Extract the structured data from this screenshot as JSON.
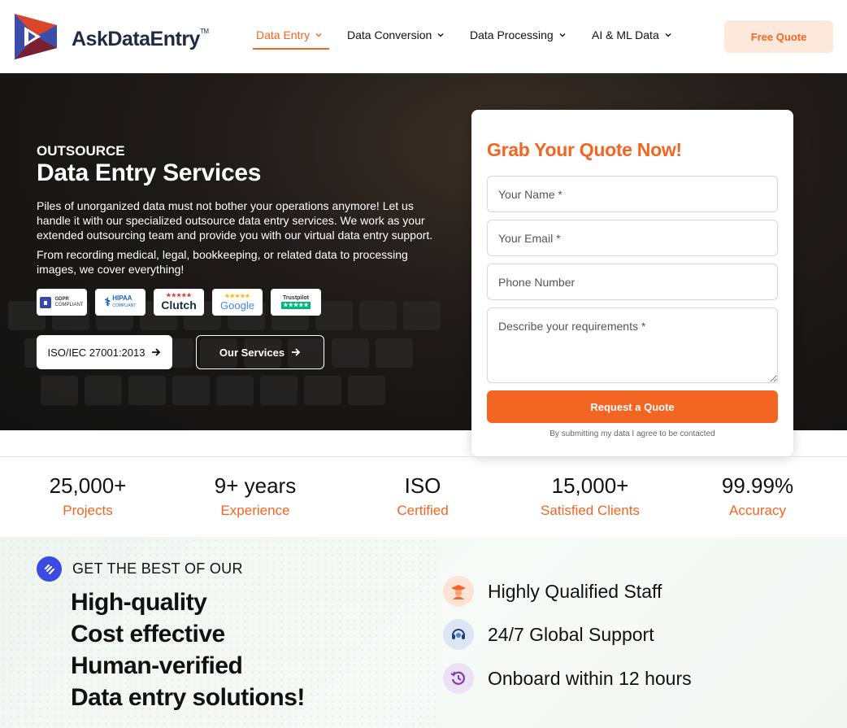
{
  "header": {
    "logo_text": "AskDataEntry",
    "logo_tm": "TM",
    "nav": [
      {
        "label": "Data Entry"
      },
      {
        "label": "Data Conversion"
      },
      {
        "label": "Data Processing"
      },
      {
        "label": "AI & ML Data"
      }
    ],
    "cta": "Free Quote",
    "accent": "#f26522"
  },
  "hero": {
    "eyebrow": "OUTSOURCE",
    "title": "Data Entry Services",
    "p1": "Piles of unorganized data must not bother your operations anymore! Let us handle it with our specialized outsource data entry services. We work as your extended outsourcing team and provide you with our virtual data entry support.",
    "p2": "From recording medical, legal, bookkeeping, or related data to processing images, we cover everything!",
    "badges": [
      {
        "label": "GDPR",
        "sub": "COMPLIANT"
      },
      {
        "label": "HIPAA",
        "sub": "COMPLIANT"
      },
      {
        "label": "Clutch",
        "sub": "★★★★★"
      },
      {
        "label": "Google",
        "sub": "★★★★★"
      },
      {
        "label": "Trustpilot",
        "sub": "★★★★★"
      }
    ],
    "btn_iso": "ISO/IEC 27001:2013",
    "btn_services": "Our Services"
  },
  "form": {
    "title": "Grab Your Quote Now!",
    "name_placeholder": "Your Name *",
    "email_placeholder": "Your Email *",
    "phone_placeholder": "Phone Number",
    "req_placeholder": "Describe your requirements *",
    "submit": "Request a Quote",
    "note": "By submitting my data I agree to be contacted"
  },
  "stats": [
    {
      "value": "25,000+",
      "label": "Projects"
    },
    {
      "value": "9+ years",
      "label": "Experience"
    },
    {
      "value": "ISO",
      "label": "Certified"
    },
    {
      "value": "15,000+",
      "label": "Satisfied Clients"
    },
    {
      "value": "99.99%",
      "label": "Accuracy"
    }
  ],
  "best": {
    "eyebrow": "GET THE BEST OF OUR",
    "lines": [
      "High-quality",
      "Cost effective",
      "Human-verified",
      "Data entry solutions!"
    ]
  },
  "features": [
    {
      "label": "Highly Qualified Staff",
      "icon": "graduate-icon"
    },
    {
      "label": "24/7 Global Support",
      "icon": "headset-icon"
    },
    {
      "label": "Onboard within 12 hours",
      "icon": "clock-history-icon"
    }
  ]
}
